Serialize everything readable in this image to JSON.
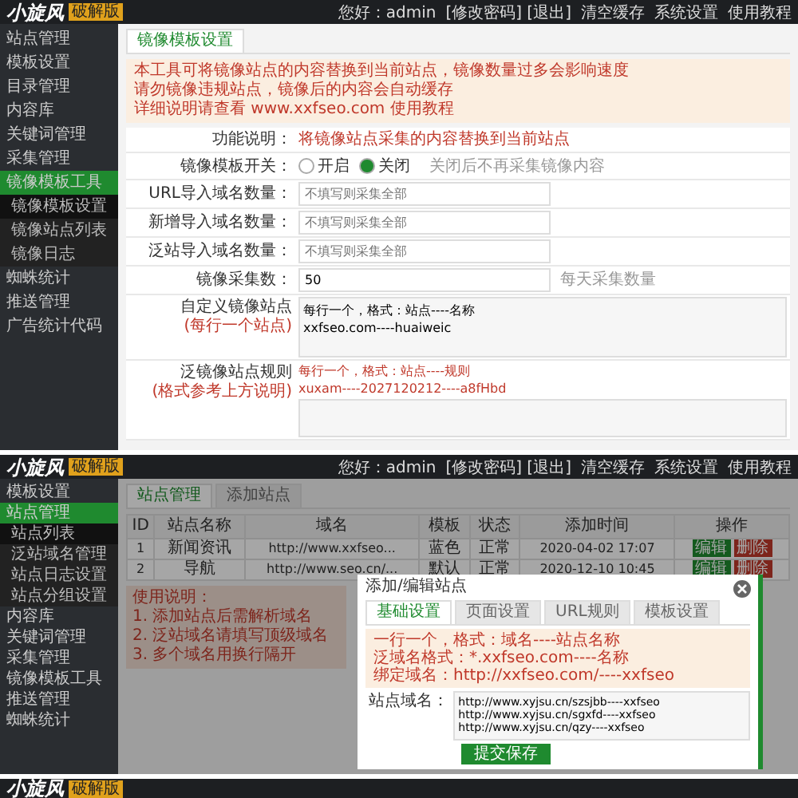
{
  "settings_screen": {
    "header": {
      "logo": "小旋风",
      "badge": "破解版",
      "links": [
        "您好：admin",
        "[修改密码] [退出]",
        "清空缓存",
        "系统设置",
        "使用教程"
      ]
    },
    "sidebar": [
      {
        "label": "站点管理",
        "selected": false
      },
      {
        "label": "模板设置",
        "selected": false
      },
      {
        "label": "目录管理",
        "selected": false
      },
      {
        "label": "内容库",
        "selected": false
      },
      {
        "label": "关键词管理",
        "selected": false
      },
      {
        "label": "采集管理",
        "selected": false
      },
      {
        "label": "镜像模板工具",
        "selected": true,
        "expanded": true,
        "children": [
          {
            "label": "镜像模板设置",
            "selected": true
          },
          {
            "label": "镜像站点列表",
            "selected": false
          },
          {
            "label": "镜像日志",
            "selected": false
          }
        ]
      },
      {
        "label": "蜘蛛统计",
        "selected": false
      },
      {
        "label": "推送管理",
        "selected": false
      },
      {
        "label": "广告统计代码",
        "selected": false
      }
    ],
    "tab": "镜像模板设置",
    "notice": [
      "本工具可将镜像站点的内容替换到当前站点，镜像数量过多会影响速度",
      "请勿镜像违规站点，镜像后的内容会自动缓存",
      "详细说明请查看 www.xxfseo.com 使用教程"
    ],
    "rows": [
      {
        "kind": "text",
        "label": "功能说明：",
        "value": "将镜像站点采集的内容替换到当前站点"
      },
      {
        "kind": "radio",
        "label": "镜像模板开关：",
        "options": [
          {
            "label": "开启",
            "selected": false
          },
          {
            "label": "关闭",
            "selected": true
          }
        ],
        "hint": "关闭后不再采集镜像内容"
      },
      {
        "kind": "input",
        "label": "URL导入域名数量：",
        "placeholder": "不填写则采集全部"
      },
      {
        "kind": "input",
        "label": "新增导入域名数量：",
        "placeholder": "不填写则采集全部"
      },
      {
        "kind": "input",
        "label": "泛站导入域名数量：",
        "placeholder": "不填写则采集全部"
      },
      {
        "kind": "input",
        "label": "镜像采集数：",
        "value": "50",
        "hint": "每天采集数量"
      },
      {
        "kind": "textarea",
        "label": "自定义镜像站点",
        "sublabel": "(每行一个站点)",
        "value": "每行一个，格式：站点----名称\nxxfseo.com----huaiweic"
      },
      {
        "kind": "textarea",
        "label": "泛镜像站点规则",
        "sublabel": "(格式参考上方说明)",
        "hint": "每行一个，格式：站点----规则\nxuxam----2027120212----a8fHbd",
        "value": ""
      }
    ]
  },
  "list_screen": {
    "header": {
      "logo": "小旋风",
      "badge": "破解版",
      "links": [
        "您好：admin",
        "[修改密码] [退出]",
        "清空缓存",
        "系统设置",
        "使用教程"
      ]
    },
    "sidebar": [
      {
        "label": "模板设置",
        "selected": false
      },
      {
        "label": "站点管理",
        "selected": true,
        "expanded": true,
        "children": [
          {
            "label": "站点列表",
            "selected": true
          },
          {
            "label": "泛站域名管理",
            "selected": false
          },
          {
            "label": "站点日志设置",
            "selected": false
          },
          {
            "label": "站点分组设置",
            "selected": false
          }
        ]
      },
      {
        "label": "内容库",
        "selected": false
      },
      {
        "label": "关键词管理",
        "selected": false
      },
      {
        "label": "采集管理",
        "selected": false
      },
      {
        "label": "镜像模板工具",
        "selected": false
      },
      {
        "label": "推送管理",
        "selected": false
      },
      {
        "label": "蜘蛛统计",
        "selected": false
      }
    ],
    "tabs": [
      {
        "label": "站点管理",
        "selected": true
      },
      {
        "label": "添加站点",
        "selected": false
      }
    ],
    "table": {
      "columns": [
        "ID",
        "站点名称",
        "域名",
        "模板",
        "状态",
        "添加时间",
        "操作"
      ],
      "rows": [
        {
          "cells": [
            "1",
            "新闻资讯",
            "http://www.xxfseo...",
            "蓝色",
            "正常",
            "2020-04-02 17:07"
          ],
          "actions": [
            {
              "label": "编辑",
              "kind": "edit"
            },
            {
              "label": "删除",
              "kind": "delete"
            }
          ]
        },
        {
          "cells": [
            "2",
            "导航",
            "http://www.seo.cn/...",
            "默认",
            "正常",
            "2020-12-10 10:45"
          ],
          "actions": [
            {
              "label": "编辑",
              "kind": "edit"
            },
            {
              "label": "删除",
              "kind": "delete"
            }
          ]
        }
      ]
    },
    "notice": [
      "使用说明：",
      "1. 添加站点后需解析域名",
      "2. 泛站域名请填写顶级域名",
      "3. 多个域名用换行隔开"
    ],
    "modal": {
      "title": "添加/编辑站点",
      "tabs": [
        {
          "label": "基础设置",
          "selected": true
        },
        {
          "label": "页面设置",
          "selected": false
        },
        {
          "label": "URL规则",
          "selected": false
        },
        {
          "label": "模板设置",
          "selected": false
        }
      ],
      "notice": [
        "一行一个，格式：域名----站点名称",
        "泛域名格式：*.xxfseo.com----名称",
        "绑定域名：http://xxfseo.com/----xxfseo"
      ],
      "field_label": "站点域名：",
      "field_value": "http://www.xyjsu.cn/szsjbb----xxfseo\nhttp://www.xyjsu.cn/sgxfd----xxfseo\nhttp://www.xyjsu.cn/qzy----xxfseo",
      "button": "提交保存"
    }
  },
  "third_screen": {
    "logo": "小旋风",
    "badge": "破解版"
  }
}
